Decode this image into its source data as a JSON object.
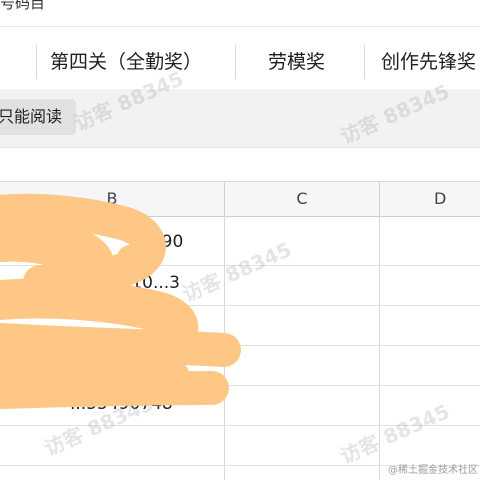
{
  "top_strip": {
    "label": "号码目"
  },
  "tabs": [
    {
      "label": "第四关（全勤奖）"
    },
    {
      "label": "劳模奖"
    },
    {
      "label": "创作先锋奖"
    }
  ],
  "toolbar": {
    "smart_read_label": "只能阅读"
  },
  "sheet": {
    "columns": [
      "B",
      "C",
      "D"
    ],
    "cells": {
      "b1": "3990",
      "b2": "14178439610...3",
      "b6": "...55490748"
    }
  },
  "watermark": {
    "text": "访客 88345"
  },
  "footer": {
    "credit": "@稀土掘金技术社区"
  },
  "colors": {
    "redaction": "#FFC786",
    "header_bg": "#f5f6f7",
    "toolbar_bg": "#f2f2f2"
  }
}
